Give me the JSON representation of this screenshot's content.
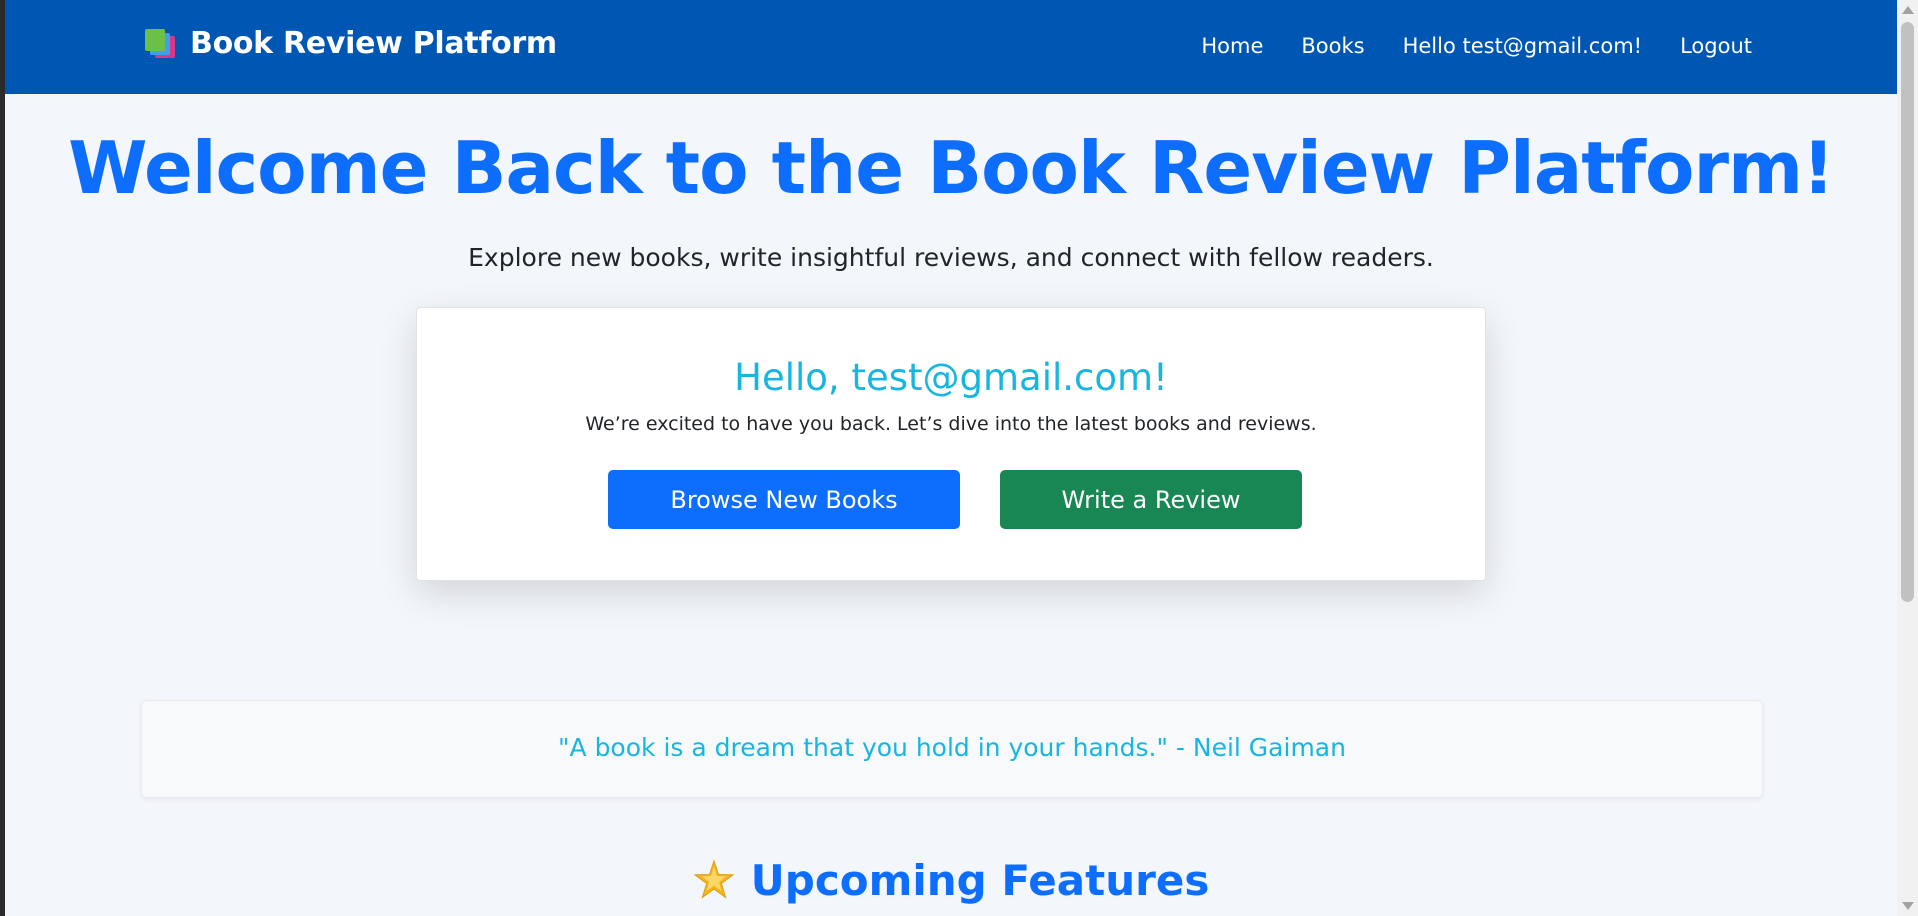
{
  "navbar": {
    "brand_icon": "books-icon",
    "brand_name": "Book Review Platform",
    "links": {
      "home": "Home",
      "books": "Books",
      "user_greeting": "Hello test@gmail.com!",
      "logout": "Logout"
    },
    "background_color": "#0056b3"
  },
  "hero": {
    "title": "Welcome Back to the Book Review Platform!",
    "subtitle": "Explore new books, write insightful reviews, and connect with fellow readers."
  },
  "welcome_card": {
    "greeting": "Hello, test@gmail.com!",
    "message": "We’re excited to have you back. Let’s dive into the latest books and reviews.",
    "browse_button": "Browse New Books",
    "review_button": "Write a Review"
  },
  "quote": {
    "text": "\"A book is a dream that you hold in your hands.\" - Neil Gaiman"
  },
  "features": {
    "icon": "glowing-star-icon",
    "heading": "Upcoming Features"
  },
  "colors": {
    "primary": "#0d6efd",
    "success": "#198754",
    "info": "#17b6e0",
    "page_background": "#f3f6fa"
  }
}
